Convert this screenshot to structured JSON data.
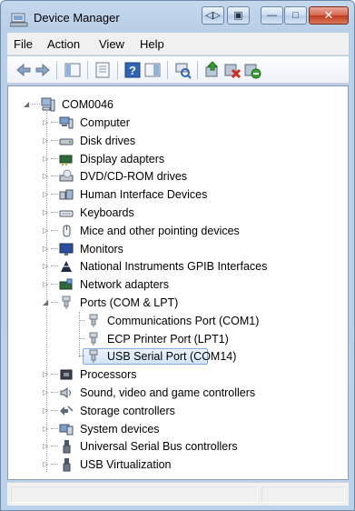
{
  "window": {
    "title": "Device Manager"
  },
  "titlebar_buttons": {
    "restore_glyph": "◁▷",
    "tile_glyph": "▣",
    "minimize_glyph": "—",
    "maximize_glyph": "□",
    "close_glyph": "✕"
  },
  "menu": [
    "File",
    "Action",
    "View",
    "Help"
  ],
  "toolbar": {
    "icons": [
      "back-arrow-icon",
      "forward-arrow-icon",
      "show-hide-tree-icon",
      "properties-icon",
      "help-icon",
      "action-pane-icon",
      "scan-hardware-icon",
      "update-driver-icon",
      "disable-device-icon",
      "uninstall-device-icon"
    ]
  },
  "tree": {
    "root": "COM0046",
    "categories": [
      {
        "label": "Computer",
        "icon": "computer-icon",
        "expanded": false
      },
      {
        "label": "Disk drives",
        "icon": "disk-drive-icon",
        "expanded": false
      },
      {
        "label": "Display adapters",
        "icon": "display-adapter-icon",
        "expanded": false
      },
      {
        "label": "DVD/CD-ROM drives",
        "icon": "dvd-drive-icon",
        "expanded": false
      },
      {
        "label": "Human Interface Devices",
        "icon": "hid-icon",
        "expanded": false
      },
      {
        "label": "Keyboards",
        "icon": "keyboard-icon",
        "expanded": false
      },
      {
        "label": "Mice and other pointing devices",
        "icon": "mouse-icon",
        "expanded": false
      },
      {
        "label": "Monitors",
        "icon": "monitor-icon",
        "expanded": false
      },
      {
        "label": "National Instruments GPIB Interfaces",
        "icon": "ni-gpib-icon",
        "expanded": false
      },
      {
        "label": "Network adapters",
        "icon": "network-adapter-icon",
        "expanded": false
      },
      {
        "label": "Ports (COM & LPT)",
        "icon": "port-icon",
        "expanded": true,
        "children": [
          {
            "label": "Communications Port (COM1)",
            "icon": "port-icon",
            "selected": false
          },
          {
            "label": "ECP Printer Port (LPT1)",
            "icon": "port-icon",
            "selected": false
          },
          {
            "label": "USB Serial Port (COM14)",
            "icon": "port-icon",
            "selected": true
          }
        ]
      },
      {
        "label": "Processors",
        "icon": "processor-icon",
        "expanded": false
      },
      {
        "label": "Sound, video and game controllers",
        "icon": "sound-icon",
        "expanded": false
      },
      {
        "label": "Storage controllers",
        "icon": "storage-controller-icon",
        "expanded": false
      },
      {
        "label": "System devices",
        "icon": "system-devices-icon",
        "expanded": false
      },
      {
        "label": "Universal Serial Bus controllers",
        "icon": "usb-controller-icon",
        "expanded": false
      },
      {
        "label": "USB Virtualization",
        "icon": "usb-controller-icon",
        "expanded": false
      }
    ]
  },
  "colors": {
    "selection_fill": "#d2e4f8",
    "selection_border": "#84acdd",
    "chrome": "#bcd2ea"
  }
}
